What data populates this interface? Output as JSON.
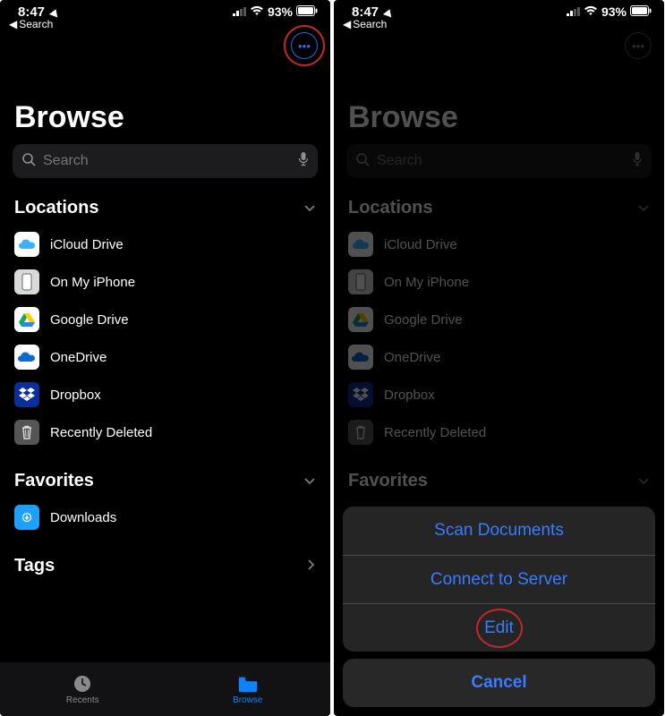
{
  "status": {
    "time": "8:47",
    "battery": "93%",
    "signal_bars": 2,
    "signal_total": 4
  },
  "back_link": "Search",
  "page_title": "Browse",
  "search": {
    "placeholder": "Search"
  },
  "sections": {
    "locations": {
      "title": "Locations",
      "items": [
        {
          "label": "iCloud Drive",
          "icon": "icloud"
        },
        {
          "label": "On My iPhone",
          "icon": "iphone"
        },
        {
          "label": "Google Drive",
          "icon": "gdrive"
        },
        {
          "label": "OneDrive",
          "icon": "onedrive"
        },
        {
          "label": "Dropbox",
          "icon": "dropbox"
        },
        {
          "label": "Recently Deleted",
          "icon": "trash"
        }
      ]
    },
    "favorites": {
      "title": "Favorites",
      "items": [
        {
          "label": "Downloads",
          "icon": "downloads"
        }
      ]
    },
    "tags": {
      "title": "Tags"
    }
  },
  "tabs": {
    "recents": "Recents",
    "browse": "Browse",
    "active": "browse"
  },
  "action_sheet": {
    "scan": "Scan Documents",
    "connect": "Connect to Server",
    "edit": "Edit",
    "cancel": "Cancel"
  },
  "highlights": {
    "left_more_button": true,
    "right_edit_button": true
  }
}
